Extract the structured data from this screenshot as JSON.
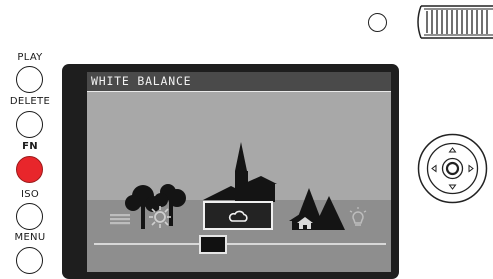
{
  "side_buttons": [
    {
      "label": "PLAY",
      "active": false
    },
    {
      "label": "DELETE",
      "active": false
    },
    {
      "label": "FN",
      "active": true
    },
    {
      "label": "ISO",
      "active": false
    },
    {
      "label": "MENU",
      "active": false
    }
  ],
  "screen": {
    "title": "WHITE BALANCE",
    "options": [
      {
        "icon": "auto-wb-icon",
        "selected": false
      },
      {
        "icon": "daylight-icon",
        "selected": false
      },
      {
        "icon": "cloudy-icon",
        "selected": true
      },
      {
        "icon": "shade-icon",
        "selected": false
      },
      {
        "icon": "tungsten-icon",
        "selected": false
      }
    ],
    "slider_position": 0.4
  },
  "colors": {
    "fn_button": "#e8262b",
    "screen_bg": "#a8a8a8",
    "title_bar": "#4a4a4a"
  },
  "icons": {
    "top_button": "round-button-icon",
    "dial": "command-dial-icon",
    "dpad": "directional-pad-icon"
  }
}
